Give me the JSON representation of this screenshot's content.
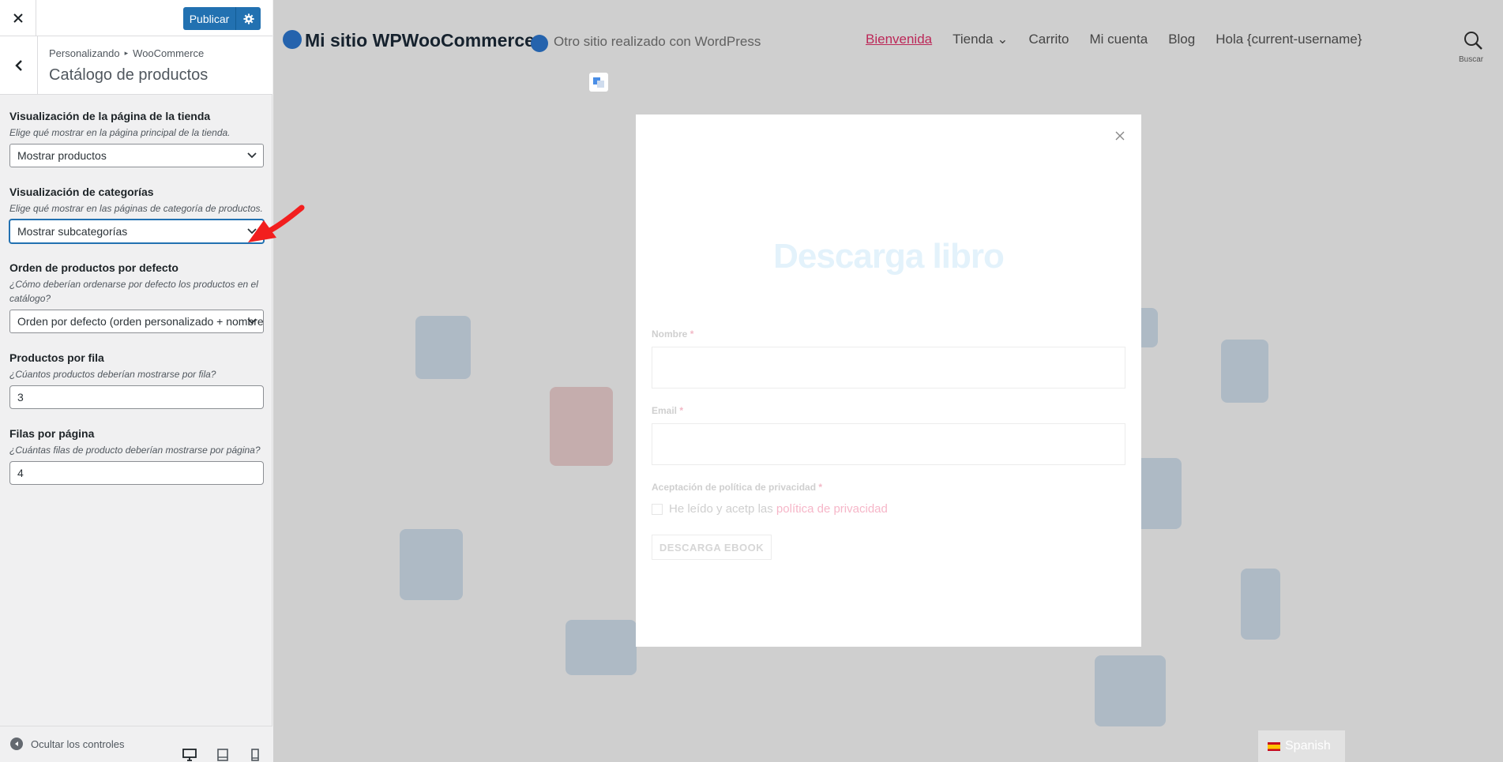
{
  "customizer": {
    "publish_label": "Publicar",
    "breadcrumb": [
      "Personalizando",
      "WooCommerce"
    ],
    "section_title": "Catálogo de productos",
    "controls": [
      {
        "title": "Visualización de la página de la tienda",
        "description": "Elige qué mostrar en la página principal de la tienda.",
        "selected": "Mostrar productos"
      },
      {
        "title": "Visualización de categorías",
        "description": "Elige qué mostrar en las páginas de categoría de productos.",
        "selected": "Mostrar subcategorías"
      },
      {
        "title": "Orden de productos por defecto",
        "description": "¿Cómo deberían ordenarse por defecto los productos en el catálogo?",
        "selected": "Orden por defecto (orden personalizado + nombre)"
      },
      {
        "title": "Productos por fila",
        "description": "¿Cúantos productos deberían mostrarse por fila?",
        "value": "3"
      },
      {
        "title": "Filas por página",
        "description": "¿Cuántas filas de producto deberían mostrarse por página?",
        "value": "4"
      }
    ],
    "hide_controls_label": "Ocultar los controles"
  },
  "site": {
    "title": "Mi sitio WPWooCommerce",
    "tagline": "Otro sitio realizado con WordPress",
    "nav": [
      "Bienvenida",
      "Tienda",
      "Carrito",
      "Mi cuenta",
      "Blog",
      "Hola {current-username}"
    ],
    "search_label": "Buscar"
  },
  "popup": {
    "title": "Descarga libro",
    "name_label": "Nombre",
    "email_label": "Email",
    "privacy_label": "Aceptación de política de privacidad",
    "required_mark": "*",
    "privacy_text": "He leído y acetp las",
    "privacy_link": "política de privacidad",
    "submit_label": "DESCARGA EBOOK"
  },
  "language": "Spanish",
  "colors": {
    "accent": "#2271b1",
    "annotation_arrow": "#f21e1e",
    "nav_active": "#e8326d"
  }
}
